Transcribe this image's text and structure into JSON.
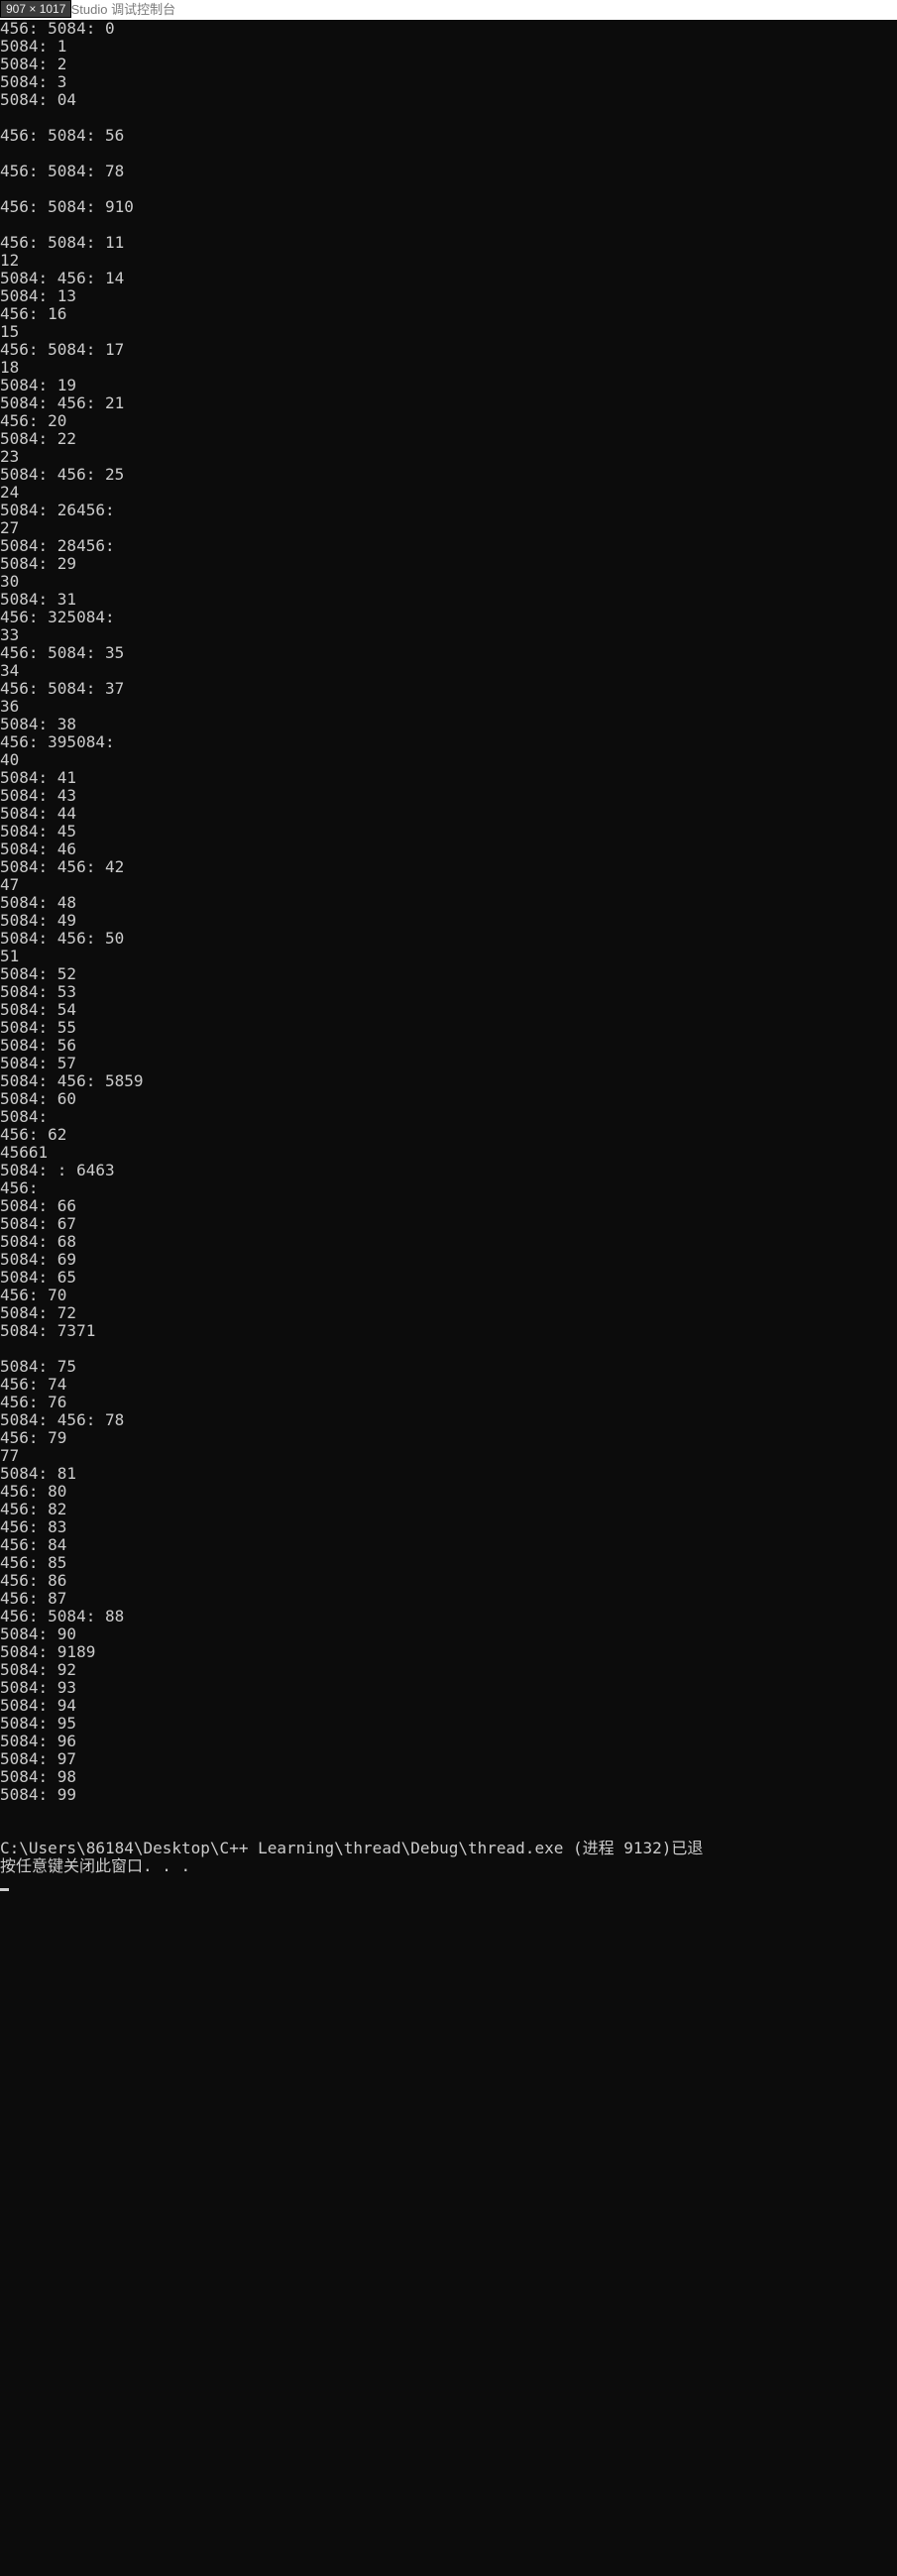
{
  "badge": "907 × 1017",
  "titlebar": "ft Visual Studio 调试控制台",
  "console_lines": [
    "456: 5084: 0",
    "5084: 1",
    "5084: 2",
    "5084: 3",
    "5084: 04",
    "",
    "456: 5084: 56",
    "",
    "456: 5084: 78",
    "",
    "456: 5084: 910",
    "",
    "456: 5084: 11",
    "12",
    "5084: 456: 14",
    "5084: 13",
    "456: 16",
    "15",
    "456: 5084: 17",
    "18",
    "5084: 19",
    "5084: 456: 21",
    "456: 20",
    "5084: 22",
    "23",
    "5084: 456: 25",
    "24",
    "5084: 26456:",
    "27",
    "5084: 28456:",
    "5084: 29",
    "30",
    "5084: 31",
    "456: 325084:",
    "33",
    "456: 5084: 35",
    "34",
    "456: 5084: 37",
    "36",
    "5084: 38",
    "456: 395084:",
    "40",
    "5084: 41",
    "5084: 43",
    "5084: 44",
    "5084: 45",
    "5084: 46",
    "5084: 456: 42",
    "47",
    "5084: 48",
    "5084: 49",
    "5084: 456: 50",
    "51",
    "5084: 52",
    "5084: 53",
    "5084: 54",
    "5084: 55",
    "5084: 56",
    "5084: 57",
    "5084: 456: 5859",
    "5084: 60",
    "5084:",
    "456: 62",
    "45661",
    "5084: : 6463",
    "456:",
    "5084: 66",
    "5084: 67",
    "5084: 68",
    "5084: 69",
    "5084: 65",
    "456: 70",
    "5084: 72",
    "5084: 7371",
    "",
    "5084: 75",
    "456: 74",
    "456: 76",
    "5084: 456: 78",
    "456: 79",
    "77",
    "5084: 81",
    "456: 80",
    "456: 82",
    "456: 83",
    "456: 84",
    "456: 85",
    "456: 86",
    "456: 87",
    "456: 5084: 88",
    "5084: 90",
    "5084: 9189",
    "5084: 92",
    "5084: 93",
    "5084: 94",
    "5084: 95",
    "5084: 96",
    "5084: 97",
    "5084: 98",
    "5084: 99"
  ],
  "exit_line": "C:\\Users\\86184\\Desktop\\C++ Learning\\thread\\Debug\\thread.exe (进程 9132)已退",
  "press_key_line": "按任意键关闭此窗口. . ."
}
